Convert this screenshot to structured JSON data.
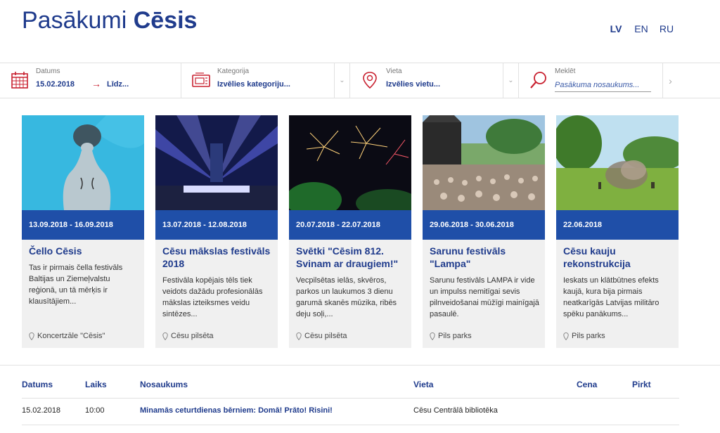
{
  "header": {
    "logo_light": "Pasākumi",
    "logo_bold": "Cēsis",
    "languages": [
      "LV",
      "EN",
      "RU"
    ],
    "active_language": "LV"
  },
  "filters": {
    "date": {
      "label": "Datums",
      "from": "15.02.2018",
      "to": "Līdz..."
    },
    "category": {
      "label": "Kategorija",
      "value": "Izvēlies kategoriju..."
    },
    "place": {
      "label": "Vieta",
      "value": "Izvēlies vietu..."
    },
    "search": {
      "label": "Meklēt",
      "placeholder": "Pasākuma nosaukums..."
    }
  },
  "cards": [
    {
      "date": "13.09.2018 - 16.09.2018",
      "title": "Čello Cēsis",
      "desc": "Tas ir pirmais čella festivāls Baltijas un Ziemeļvalstu reģionā, un tā mērķis ir klausītājiem...",
      "place": "Koncertzāle \"Cēsis\""
    },
    {
      "date": "13.07.2018 - 12.08.2018",
      "title": "Cēsu mākslas festivāls 2018",
      "desc": "Festivāla kopējais tēls tiek veidots dažādu profesionālās mākslas izteiksmes veidu sintēzes...",
      "place": "Cēsu pilsēta"
    },
    {
      "date": "20.07.2018 - 22.07.2018",
      "title": "Svētki \"Cēsim 812. Svinam ar draugiem!\"",
      "desc": "Vecpilsētas ielās, skvēros, parkos un laukumos 3 dienu garumā skanēs mūzika, ribēs deju soļi,...",
      "place": "Cēsu pilsēta"
    },
    {
      "date": "29.06.2018 - 30.06.2018",
      "title": "Sarunu festivāls \"Lampa\"",
      "desc": "Sarunu festivāls LAMPA ir vide un impulss nemitīgai sevis pilnveidošanai mūžīgi mainīgajā pasaulē.",
      "place": "Pils parks"
    },
    {
      "date": "22.06.2018",
      "title": "Cēsu kauju rekonstrukcija",
      "desc": "Ieskats un klātbūtnes efekts kaujā, kura bija pirmais neatkarīgās Latvijas militāro spēku panākums...",
      "place": "Pils parks"
    }
  ],
  "table": {
    "headers": {
      "date": "Datums",
      "time": "Laiks",
      "name": "Nosaukums",
      "place": "Vieta",
      "price": "Cena",
      "buy": "Pirkt"
    },
    "rows": [
      {
        "date": "15.02.2018",
        "time": "10:00",
        "name": "Minamās ceturtdienas bērniem: Domā! Prāto! Risini!",
        "place": "Cēsu Centrālā bibliotēka"
      }
    ]
  },
  "colors": {
    "brand": "#1f3b8c",
    "date_band": "#1f4fa8",
    "accent_red": "#c8202f"
  }
}
